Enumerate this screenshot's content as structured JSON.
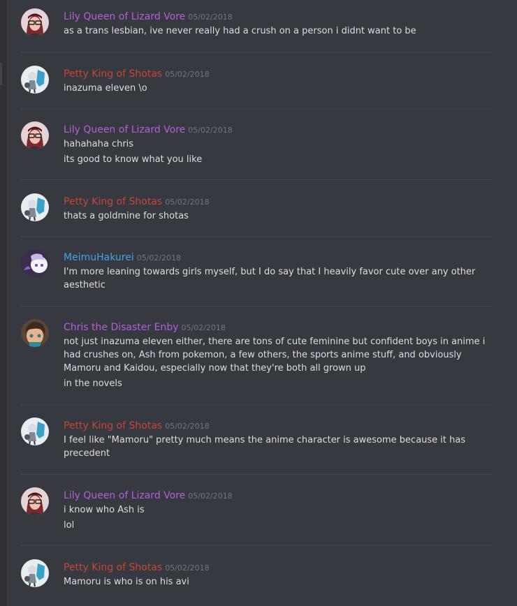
{
  "colors": {
    "background": "#36393f",
    "lily": "#b460d6",
    "petty": "#c84634",
    "meimu": "#44a3e8",
    "chris": "#b460d6",
    "text": "#dcddde",
    "timestamp": "#72767d"
  },
  "messages": [
    {
      "author": "Lily Queen of Lizard Vore",
      "timestamp": "05/02/2018",
      "avatar": "lily-avatar-icon",
      "lines": [
        "as a trans lesbian, ive never really had a crush on a person i didnt want to be"
      ]
    },
    {
      "author": "Petty King of Shotas",
      "timestamp": "05/02/2018",
      "avatar": "petty-avatar-icon",
      "lines": [
        "inazuma eleven \\o"
      ]
    },
    {
      "author": "Lily Queen of Lizard Vore",
      "timestamp": "05/02/2018",
      "avatar": "lily-avatar-icon",
      "lines": [
        "hahahaha chris",
        "its good to know what you like"
      ]
    },
    {
      "author": "Petty King of Shotas",
      "timestamp": "05/02/2018",
      "avatar": "petty-avatar-icon",
      "lines": [
        "thats a goldmine for shotas"
      ]
    },
    {
      "author": "MeimuHakurei",
      "timestamp": "05/02/2018",
      "avatar": "meimu-avatar-icon",
      "lines": [
        "I'm more leaning towards girls myself, but I do say that I heavily favor cute over any other aesthetic"
      ]
    },
    {
      "author": "Chris the Disaster Enby",
      "timestamp": "05/02/2018",
      "avatar": "chris-avatar-icon",
      "lines": [
        "not just inazuma eleven either, there are tons of cute feminine but confident boys in anime i had crushes on, Ash from pokemon, a few others, the sports anime stuff, and obviously Mamoru and Kaidou, especially now that they're both all grown up",
        "in the novels"
      ]
    },
    {
      "author": "Petty King of Shotas",
      "timestamp": "05/02/2018",
      "avatar": "petty-avatar-icon",
      "lines": [
        "I feel like \"Mamoru\" pretty much means the anime character is awesome because it has precedent"
      ]
    },
    {
      "author": "Lily Queen of Lizard Vore",
      "timestamp": "05/02/2018",
      "avatar": "lily-avatar-icon",
      "lines": [
        "i know who Ash is",
        "lol"
      ]
    },
    {
      "author": "Petty King of Shotas",
      "timestamp": "05/02/2018",
      "avatar": "petty-avatar-icon",
      "lines": [
        "Mamoru is who is on his avi"
      ]
    }
  ]
}
